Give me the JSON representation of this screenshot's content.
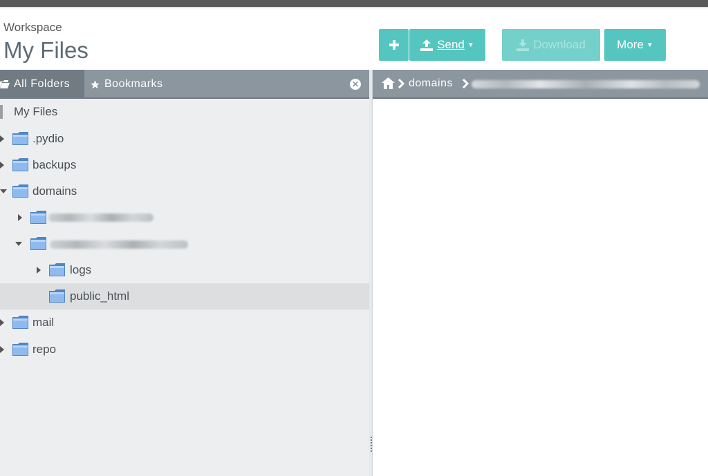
{
  "header": {
    "workspace_label": "Workspace",
    "title": "My Files"
  },
  "toolbar": {
    "new_icon": "plus-icon",
    "send_label": "Send",
    "send_icon": "upload-icon",
    "download_label": "Download",
    "download_icon": "download-icon",
    "more_label": "More",
    "accent_color": "#55c5bf"
  },
  "left_tabs": {
    "all_folders": "All Folders",
    "bookmarks": "Bookmarks"
  },
  "tree": {
    "root": "My Files",
    "items": [
      {
        "label": ".pydio"
      },
      {
        "label": "backups"
      },
      {
        "label": "domains"
      },
      {
        "label": "logs"
      },
      {
        "label": "public_html"
      },
      {
        "label": "mail"
      },
      {
        "label": "repo"
      }
    ]
  },
  "breadcrumb": {
    "segment": "domains"
  }
}
